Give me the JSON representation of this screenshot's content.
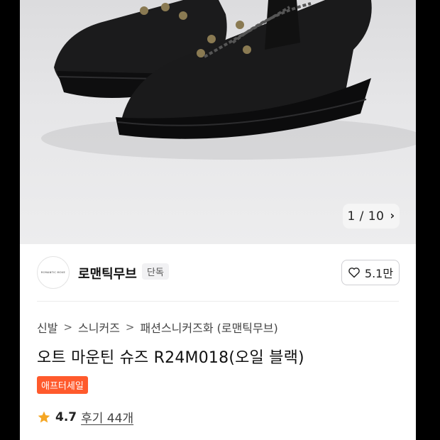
{
  "gallery": {
    "position": "1 / 10",
    "chevron_icon": "chevron-right-icon"
  },
  "brand": {
    "logo_text": "ROMANTIC MOVE",
    "name": "로맨틱무브",
    "tag": "단독",
    "like_count": "5.1만",
    "like_icon": "heart-icon"
  },
  "breadcrumb": {
    "items": [
      "신발",
      "스니커즈",
      "패션스니커즈화 (로맨틱무브)"
    ],
    "separator": ">"
  },
  "product": {
    "title": "오트 마운틴 슈즈 R24M018(오일 블랙)",
    "sale_badge": "애프터세일",
    "rating": "4.7",
    "reviews": "후기 44개"
  },
  "colors": {
    "sale": "#ff5a2c",
    "star": "#f5a623"
  }
}
